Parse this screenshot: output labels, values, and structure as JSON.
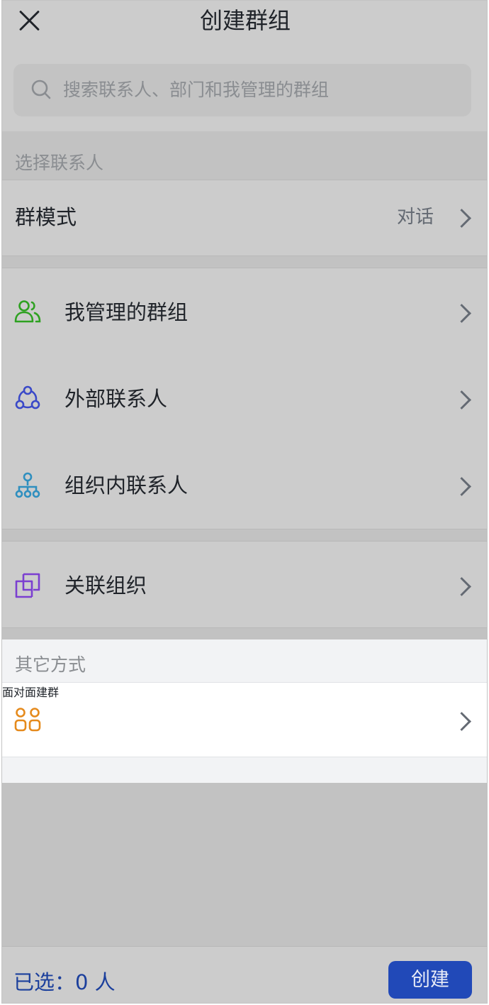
{
  "header": {
    "title": "创建群组"
  },
  "search": {
    "placeholder": "搜索联系人、部门和我管理的群组"
  },
  "sections": {
    "select_contacts": "选择联系人",
    "other_methods": "其它方式"
  },
  "group_mode": {
    "label": "群模式",
    "value": "对话"
  },
  "contact_items": [
    {
      "label": "我管理的群组",
      "icon": "people-group-icon",
      "color": "#2ea121"
    },
    {
      "label": "外部联系人",
      "icon": "external-contacts-icon",
      "color": "#3a49c8"
    },
    {
      "label": "组织内联系人",
      "icon": "org-tree-icon",
      "color": "#2f8fbf"
    }
  ],
  "linked_org": {
    "label": "关联组织",
    "icon": "linked-org-icon",
    "color": "#7b3fd0"
  },
  "face_to_face": {
    "label": "面对面建群",
    "icon": "face-to-face-icon",
    "color": "#e58a1c"
  },
  "footer": {
    "selected_text": "已选：0 人",
    "create_label": "创建"
  },
  "colors": {
    "primary": "#2149b8",
    "selected_text": "#1b3f9c"
  }
}
